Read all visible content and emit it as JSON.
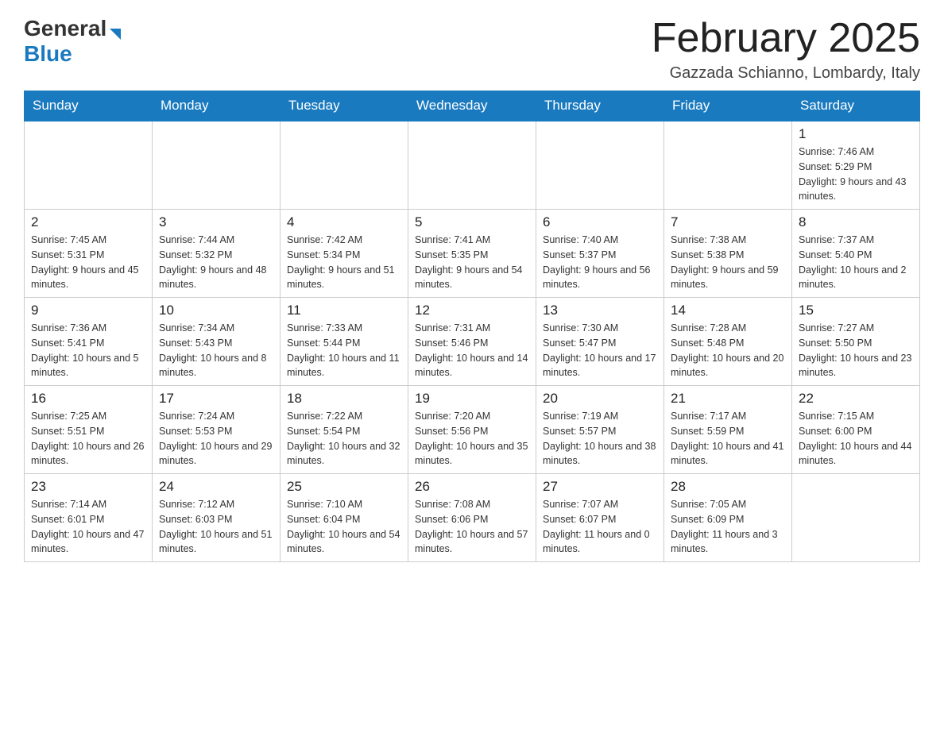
{
  "header": {
    "logo_general": "General",
    "logo_blue": "Blue",
    "month_title": "February 2025",
    "location": "Gazzada Schianno, Lombardy, Italy"
  },
  "days_of_week": [
    "Sunday",
    "Monday",
    "Tuesday",
    "Wednesday",
    "Thursday",
    "Friday",
    "Saturday"
  ],
  "weeks": [
    [
      {
        "day": "",
        "info": ""
      },
      {
        "day": "",
        "info": ""
      },
      {
        "day": "",
        "info": ""
      },
      {
        "day": "",
        "info": ""
      },
      {
        "day": "",
        "info": ""
      },
      {
        "day": "",
        "info": ""
      },
      {
        "day": "1",
        "info": "Sunrise: 7:46 AM\nSunset: 5:29 PM\nDaylight: 9 hours and 43 minutes."
      }
    ],
    [
      {
        "day": "2",
        "info": "Sunrise: 7:45 AM\nSunset: 5:31 PM\nDaylight: 9 hours and 45 minutes."
      },
      {
        "day": "3",
        "info": "Sunrise: 7:44 AM\nSunset: 5:32 PM\nDaylight: 9 hours and 48 minutes."
      },
      {
        "day": "4",
        "info": "Sunrise: 7:42 AM\nSunset: 5:34 PM\nDaylight: 9 hours and 51 minutes."
      },
      {
        "day": "5",
        "info": "Sunrise: 7:41 AM\nSunset: 5:35 PM\nDaylight: 9 hours and 54 minutes."
      },
      {
        "day": "6",
        "info": "Sunrise: 7:40 AM\nSunset: 5:37 PM\nDaylight: 9 hours and 56 minutes."
      },
      {
        "day": "7",
        "info": "Sunrise: 7:38 AM\nSunset: 5:38 PM\nDaylight: 9 hours and 59 minutes."
      },
      {
        "day": "8",
        "info": "Sunrise: 7:37 AM\nSunset: 5:40 PM\nDaylight: 10 hours and 2 minutes."
      }
    ],
    [
      {
        "day": "9",
        "info": "Sunrise: 7:36 AM\nSunset: 5:41 PM\nDaylight: 10 hours and 5 minutes."
      },
      {
        "day": "10",
        "info": "Sunrise: 7:34 AM\nSunset: 5:43 PM\nDaylight: 10 hours and 8 minutes."
      },
      {
        "day": "11",
        "info": "Sunrise: 7:33 AM\nSunset: 5:44 PM\nDaylight: 10 hours and 11 minutes."
      },
      {
        "day": "12",
        "info": "Sunrise: 7:31 AM\nSunset: 5:46 PM\nDaylight: 10 hours and 14 minutes."
      },
      {
        "day": "13",
        "info": "Sunrise: 7:30 AM\nSunset: 5:47 PM\nDaylight: 10 hours and 17 minutes."
      },
      {
        "day": "14",
        "info": "Sunrise: 7:28 AM\nSunset: 5:48 PM\nDaylight: 10 hours and 20 minutes."
      },
      {
        "day": "15",
        "info": "Sunrise: 7:27 AM\nSunset: 5:50 PM\nDaylight: 10 hours and 23 minutes."
      }
    ],
    [
      {
        "day": "16",
        "info": "Sunrise: 7:25 AM\nSunset: 5:51 PM\nDaylight: 10 hours and 26 minutes."
      },
      {
        "day": "17",
        "info": "Sunrise: 7:24 AM\nSunset: 5:53 PM\nDaylight: 10 hours and 29 minutes."
      },
      {
        "day": "18",
        "info": "Sunrise: 7:22 AM\nSunset: 5:54 PM\nDaylight: 10 hours and 32 minutes."
      },
      {
        "day": "19",
        "info": "Sunrise: 7:20 AM\nSunset: 5:56 PM\nDaylight: 10 hours and 35 minutes."
      },
      {
        "day": "20",
        "info": "Sunrise: 7:19 AM\nSunset: 5:57 PM\nDaylight: 10 hours and 38 minutes."
      },
      {
        "day": "21",
        "info": "Sunrise: 7:17 AM\nSunset: 5:59 PM\nDaylight: 10 hours and 41 minutes."
      },
      {
        "day": "22",
        "info": "Sunrise: 7:15 AM\nSunset: 6:00 PM\nDaylight: 10 hours and 44 minutes."
      }
    ],
    [
      {
        "day": "23",
        "info": "Sunrise: 7:14 AM\nSunset: 6:01 PM\nDaylight: 10 hours and 47 minutes."
      },
      {
        "day": "24",
        "info": "Sunrise: 7:12 AM\nSunset: 6:03 PM\nDaylight: 10 hours and 51 minutes."
      },
      {
        "day": "25",
        "info": "Sunrise: 7:10 AM\nSunset: 6:04 PM\nDaylight: 10 hours and 54 minutes."
      },
      {
        "day": "26",
        "info": "Sunrise: 7:08 AM\nSunset: 6:06 PM\nDaylight: 10 hours and 57 minutes."
      },
      {
        "day": "27",
        "info": "Sunrise: 7:07 AM\nSunset: 6:07 PM\nDaylight: 11 hours and 0 minutes."
      },
      {
        "day": "28",
        "info": "Sunrise: 7:05 AM\nSunset: 6:09 PM\nDaylight: 11 hours and 3 minutes."
      },
      {
        "day": "",
        "info": ""
      }
    ]
  ]
}
